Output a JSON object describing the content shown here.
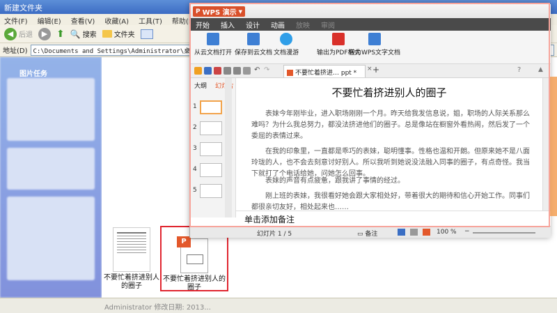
{
  "explorer": {
    "title": "新建文件夹",
    "menu": [
      "文件(F)",
      "编辑(E)",
      "查看(V)",
      "收藏(A)",
      "工具(T)",
      "帮助(H)"
    ],
    "toolbar": {
      "back": "后退",
      "search": "搜索",
      "folders": "文件夹"
    },
    "address_label": "地址(D)",
    "address_value": "C:\\Documents and Settings\\Administrator\\桌面\\新建文件夹",
    "task_title": "图片任务",
    "status": "Administrator  修改日期: 2013..."
  },
  "files": [
    {
      "name": "不要忙着挤进别人的圈子"
    },
    {
      "name": "不要忙着挤进别人的圈子"
    }
  ],
  "wps": {
    "app_name": "WPS 演示",
    "tabs": [
      "开始",
      "插入",
      "设计",
      "动画",
      "放映",
      "审阅"
    ],
    "ribbon": [
      "从云文档打开",
      "保存到云文档",
      "文档漫游",
      "输出为PDF格式",
      "转为WPS文字文档"
    ],
    "doc_tab": "不要忙着挤进… ppt *",
    "sidebar_tabs": [
      "大纲",
      "幻灯片"
    ],
    "slide_numbers": [
      "1",
      "2",
      "3",
      "4",
      "5"
    ],
    "slide": {
      "title": "不要忙着挤进别人的圈子",
      "paragraphs": [
        "表妹今年刚毕业，进入职场刚刚一个月。昨天给我发信息说，姐，职场的人际关系那么难吗？为什么我总努力，都没法挤进他们的圈子。总是像站在橱窗外看热闹，然后发了一个委屈的表情过来。",
        "在我的印象里，一直都是乖巧的表妹，聪明懂事。性格也温和开朗。但原来她不是八面玲珑的人，也不会去刻意讨好别人。所以我听到她说没法融入同事的圈子，有点奇怪。我当下就打了个电话给她，问她怎么回事。",
        "表妹的声音有点疲惫，跟我讲了事情的经过。",
        "刚上班的表妹，我很看好她会跟大家相处好，带着很大的期待和信心开始工作。同事们都很亲切友好，相处起来也……"
      ]
    },
    "notes_placeholder": "单击添加备注",
    "status": {
      "slide_counter": "幻灯片 1 / 5",
      "notes": "备注",
      "zoom": "100 %"
    }
  }
}
